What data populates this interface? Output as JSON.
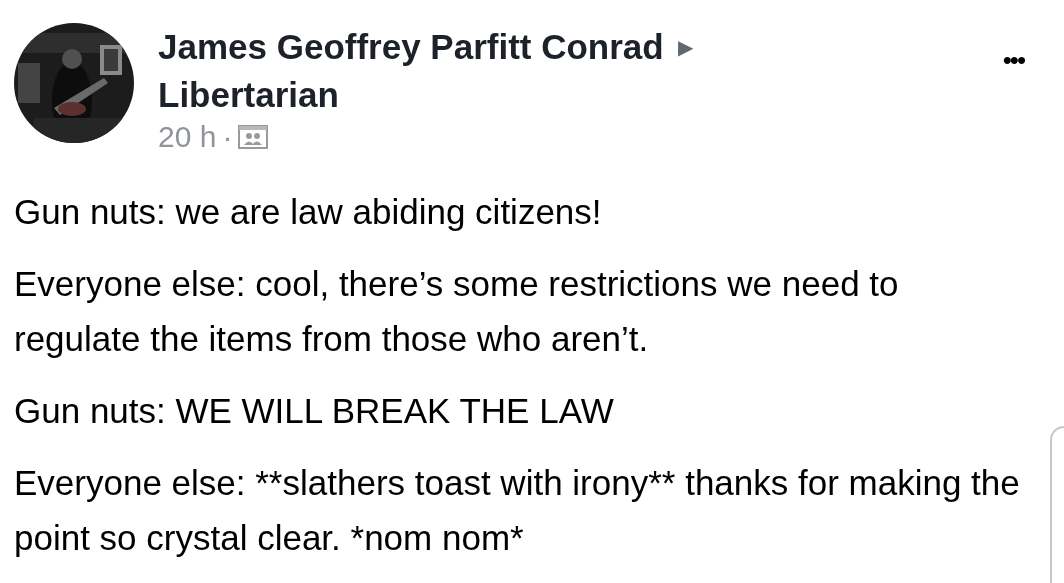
{
  "post": {
    "author": "James Geoffrey Parfitt Conrad",
    "audience_arrow": "▶",
    "group": "Libertarian",
    "time": "20 h",
    "separator": "·",
    "menu": "•••",
    "paragraphs": [
      "Gun nuts: we are law abiding citizens!",
      "Everyone else: cool, there’s some restrictions we need to regulate the items from those who aren’t.",
      "Gun nuts: WE WILL BREAK THE LAW",
      "Everyone else: **slathers toast with irony** thanks for making the point so crystal clear. *nom nom*"
    ]
  }
}
